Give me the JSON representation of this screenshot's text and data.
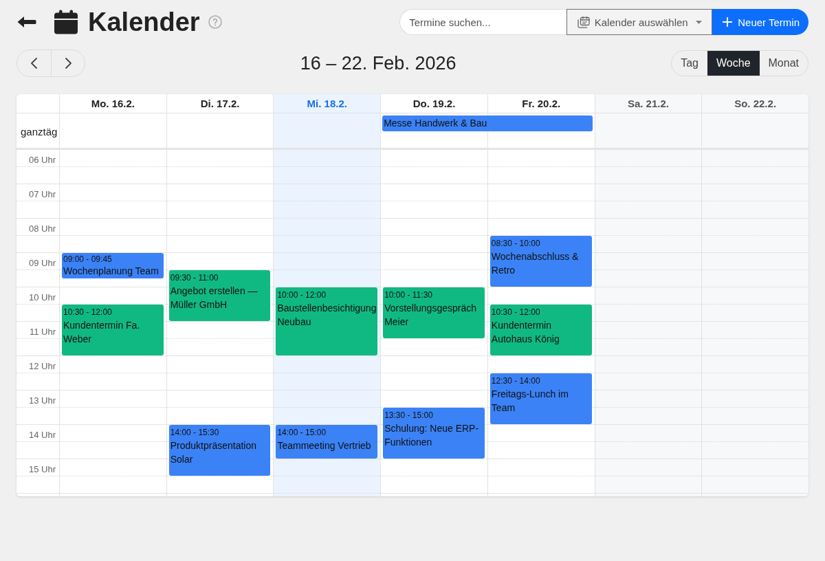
{
  "header": {
    "title": "Kalender"
  },
  "toolbar": {
    "search": {
      "placeholder": "Termine suchen..."
    },
    "calendar_select": {
      "label": "Kalender auswählen"
    },
    "new_button": {
      "label": "Neuer Termin"
    }
  },
  "range_title": "16 – 22. Feb. 2026",
  "views": [
    {
      "label": "Tag",
      "selected": false
    },
    {
      "label": "Woche",
      "selected": true
    },
    {
      "label": "Monat",
      "selected": false
    }
  ],
  "calendar": {
    "all_day_label": "ganztäg",
    "hours": [
      "06 Uhr",
      "07 Uhr",
      "08 Uhr",
      "09 Uhr",
      "10 Uhr",
      "11 Uhr",
      "12 Uhr",
      "13 Uhr",
      "14 Uhr",
      "15 Uhr"
    ],
    "days": [
      {
        "label": "Mo. 16.2.",
        "kind": "workday",
        "events": [
          {
            "time": "09:00 - 09:45",
            "title": "Wochenplanung Team",
            "color": "#3b82f6"
          },
          {
            "time": "10:30 - 12:00",
            "title": "Kundentermin Fa. Weber",
            "color": "#10b981"
          }
        ]
      },
      {
        "label": "Di. 17.2.",
        "kind": "workday",
        "events": [
          {
            "time": "09:30 - 11:00",
            "title": "Angebot erstellen — Müller GmbH",
            "color": "#10b981"
          },
          {
            "time": "14:00 - 15:30",
            "title": "Produktpräsentation Solar",
            "color": "#3b82f6"
          }
        ]
      },
      {
        "label": "Mi. 18.2.",
        "kind": "today",
        "events": [
          {
            "time": "10:00 - 12:00",
            "title": "Baustellenbesichtigung Neubau",
            "color": "#10b981"
          },
          {
            "time": "14:00 - 15:00",
            "title": "Teammeeting Vertrieb",
            "color": "#3b82f6"
          }
        ]
      },
      {
        "label": "Do. 19.2.",
        "kind": "workday",
        "all_day": [
          {
            "title": "Messe Handwerk & Bau",
            "color": "#3b82f6",
            "extends_next_day": true
          }
        ],
        "events": [
          {
            "time": "10:00 - 11:30",
            "title": "Vorstellungsgespräch Meier",
            "color": "#10b981"
          },
          {
            "time": "13:30 - 15:00",
            "title": "Schulung: Neue ERP-Funktionen",
            "color": "#3b82f6"
          }
        ]
      },
      {
        "label": "Fr. 20.2.",
        "kind": "workday",
        "events": [
          {
            "time": "08:30 - 10:00",
            "title": "Wochenabschluss & Retro",
            "color": "#3b82f6"
          },
          {
            "time": "10:30 - 12:00",
            "title": "Kundentermin Autohaus König",
            "color": "#10b981"
          },
          {
            "time": "12:30 - 14:00",
            "title": "Freitags-Lunch im Team",
            "color": "#3b82f6"
          }
        ]
      },
      {
        "label": "Sa. 21.2.",
        "kind": "weekend"
      },
      {
        "label": "So. 22.2.",
        "kind": "weekend"
      }
    ]
  }
}
